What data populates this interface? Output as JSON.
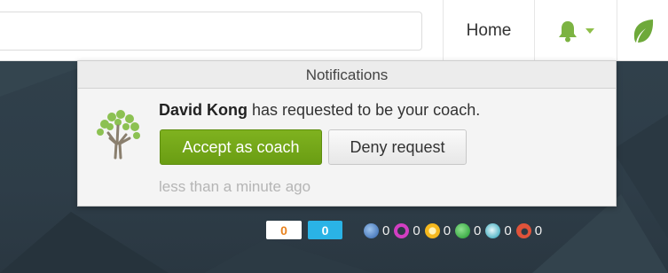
{
  "header": {
    "search_value": "",
    "home_label": "Home"
  },
  "icons": {
    "bell": "bell-icon",
    "caret": "caret-down-icon",
    "leaf": "leaf-icon",
    "avatar": "tree-avatar-icon"
  },
  "colors": {
    "accent_green": "#7cb342",
    "accept_button": "#72a617",
    "hero_background": "#2e3d48",
    "energy_badge_text": "#e8821e",
    "streak_badge": "#2ab3e6"
  },
  "notifications": {
    "title": "Notifications",
    "item": {
      "user_name": "David Kong",
      "message": "has requested to be your coach.",
      "accept_label": "Accept as coach",
      "deny_label": "Deny request",
      "time": "less than a minute ago"
    }
  },
  "stats": {
    "energy_points": "0",
    "streak": "0",
    "badges": [
      {
        "icon": "meteorite-badge-icon",
        "color": "#4f7fbf",
        "count": "0"
      },
      {
        "icon": "moon-badge-icon",
        "color": "#d23ec2",
        "count": "0"
      },
      {
        "icon": "earth-badge-icon",
        "color": "#f5b81e",
        "count": "0"
      },
      {
        "icon": "sun-badge-icon",
        "color": "#3fae49",
        "count": "0"
      },
      {
        "icon": "black-hole-badge-icon",
        "color": "#56b7c7",
        "count": "0"
      },
      {
        "icon": "challenge-patch-icon",
        "color": "#e0533a",
        "count": "0"
      }
    ]
  }
}
